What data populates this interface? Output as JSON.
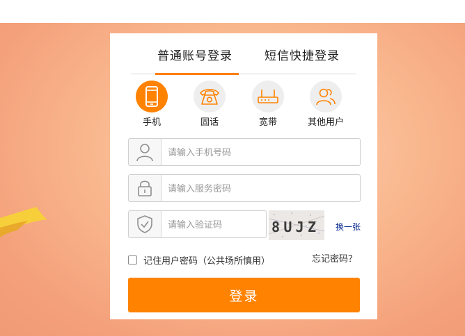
{
  "tabs": [
    {
      "label": "普通账号登录",
      "active": true
    },
    {
      "label": "短信快捷登录",
      "active": false
    }
  ],
  "account_types": [
    {
      "label": "手机",
      "icon": "mobile-phone-icon",
      "active": true
    },
    {
      "label": "固话",
      "icon": "telephone-icon",
      "active": false
    },
    {
      "label": "宽带",
      "icon": "router-icon",
      "active": false
    },
    {
      "label": "其他用户",
      "icon": "users-icon",
      "active": false
    }
  ],
  "fields": {
    "phone": {
      "placeholder": "请输入手机号码",
      "value": "",
      "icon": "user-icon"
    },
    "password": {
      "placeholder": "请输入服务密码",
      "value": "",
      "icon": "lock-icon"
    },
    "captcha": {
      "placeholder": "请输入验证码",
      "value": "",
      "icon": "shield-check-icon"
    }
  },
  "captcha_image": {
    "text": "8UJZ"
  },
  "swap_label": "换一张",
  "remember": {
    "label": "记住用户密码（公共场所慎用）",
    "checked": false
  },
  "forgot_label": "忘记密码？",
  "login_label": "登录",
  "colors": {
    "accent": "#ff8200",
    "banner": "#f9b78e"
  }
}
